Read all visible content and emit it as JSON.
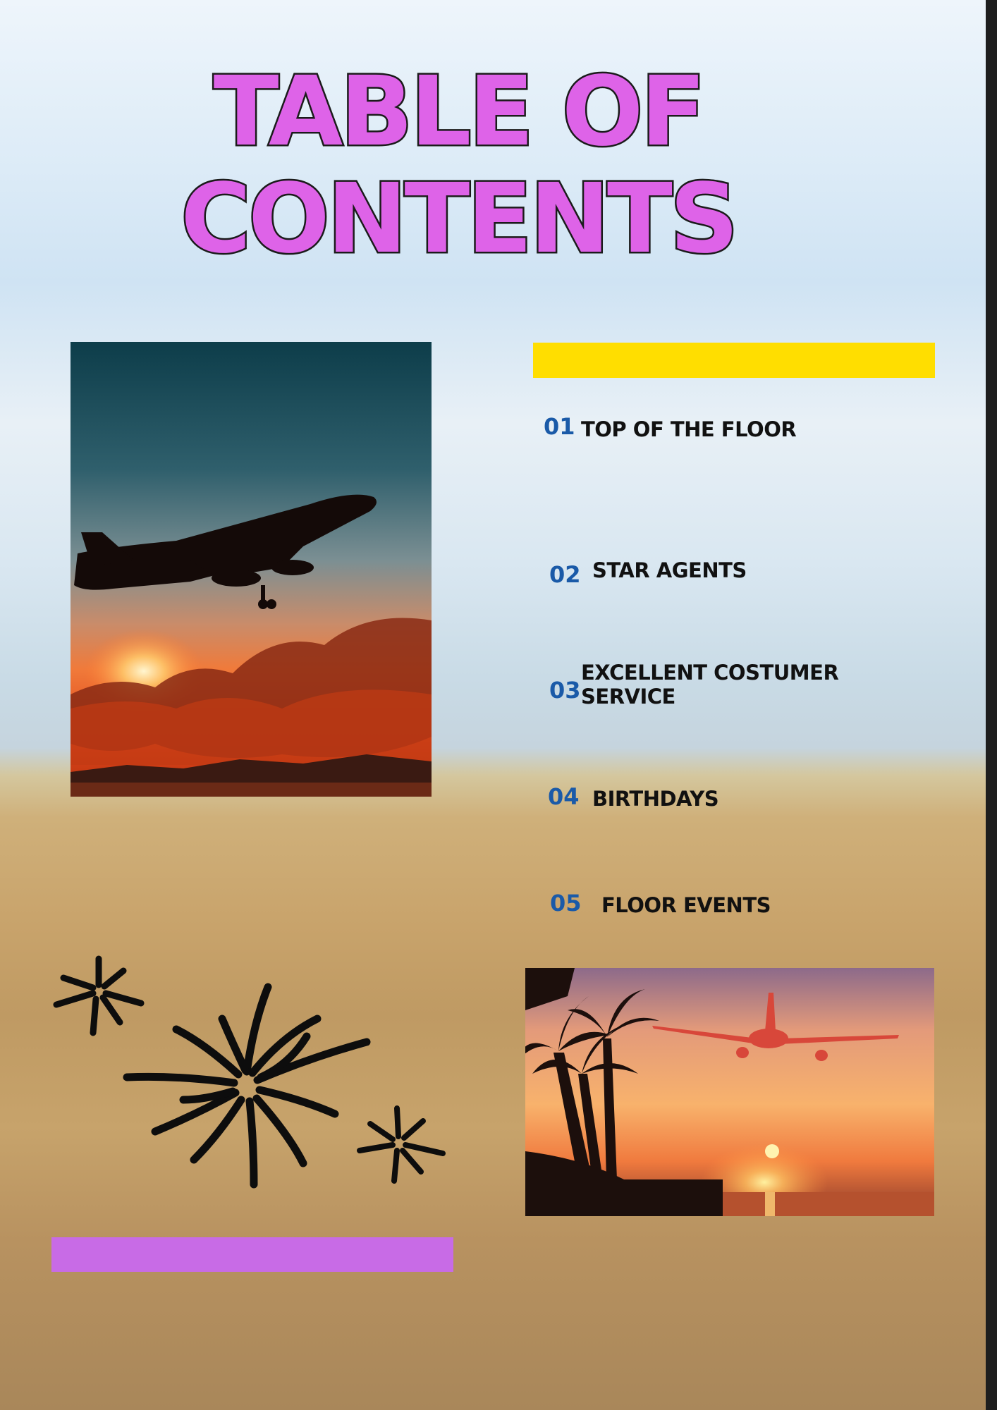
{
  "title": {
    "line1": "TABLE OF",
    "line2": "CONTENTS"
  },
  "toc": {
    "items": [
      {
        "number": "01",
        "label": "TOP OF THE FLOOR"
      },
      {
        "number": "02",
        "label": "STAR AGENTS"
      },
      {
        "number": "03",
        "label_line1": "EXCELLENT COSTUMER",
        "label_line2": "SERVICE"
      },
      {
        "number": "04",
        "label": "BIRTHDAYS"
      },
      {
        "number": "05",
        "label": "FLOOR EVENTS"
      }
    ]
  },
  "colors": {
    "title_fill": "#de63e8",
    "title_outline": "#1b1b1b",
    "number": "#1a5aa8",
    "accent_yellow": "#ffde00",
    "accent_purple": "#c86be6"
  },
  "images": {
    "photo_1": "airplane-takeoff-sunset-photo",
    "photo_2": "airplane-palm-beach-sunset-photo",
    "decoration": "fireworks-icon"
  }
}
